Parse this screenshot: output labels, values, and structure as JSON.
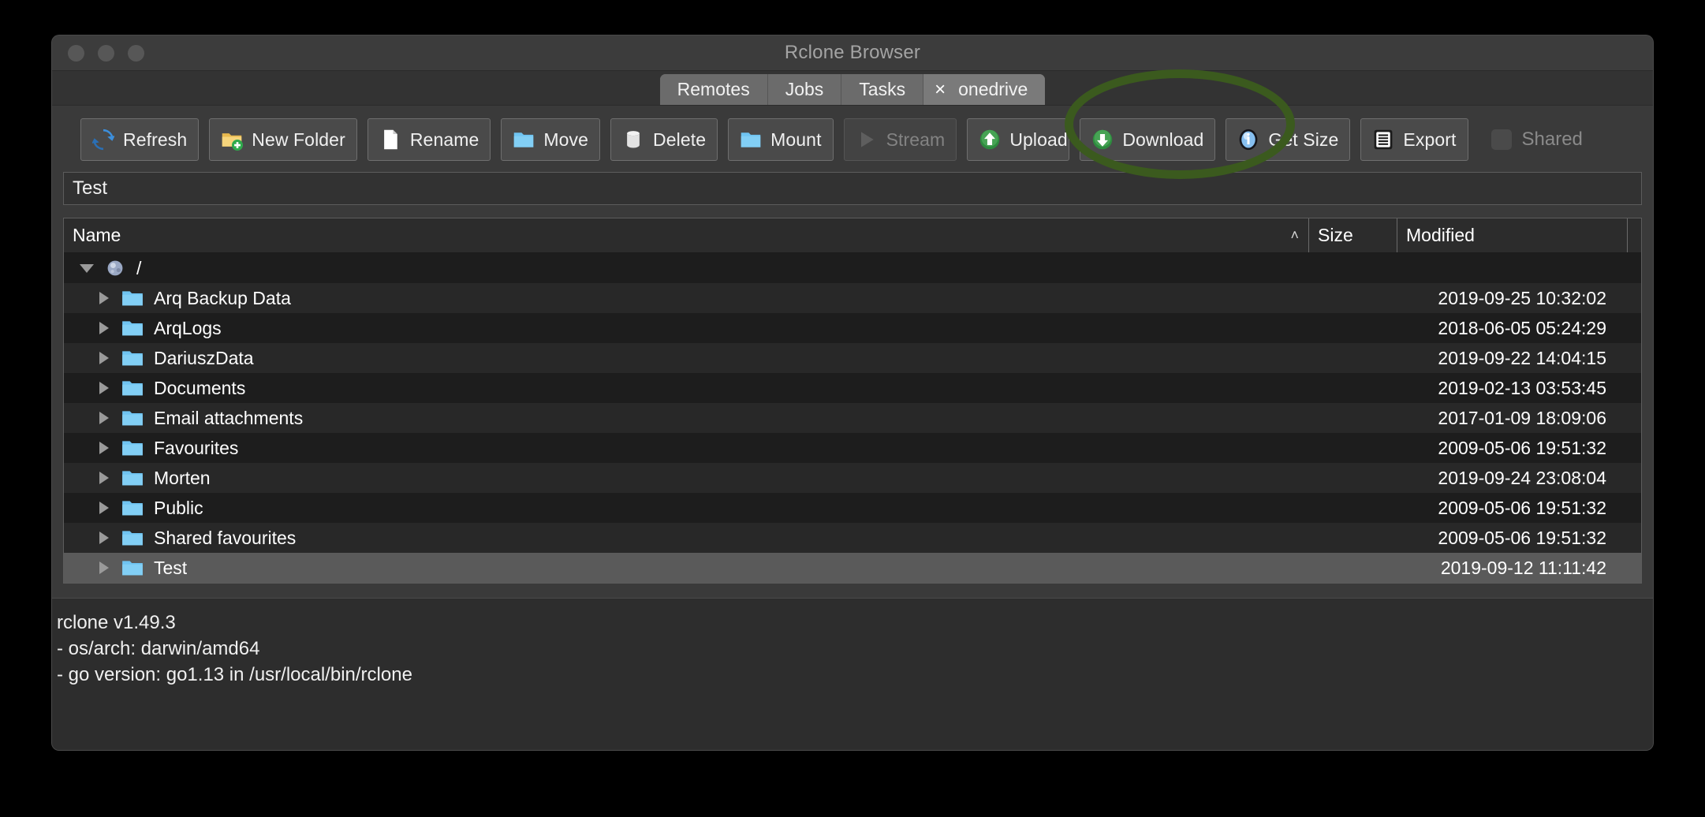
{
  "window": {
    "title": "Rclone Browser",
    "traffic_lights": [
      "close-button",
      "minimize-button",
      "maximize-button"
    ]
  },
  "tabs": [
    {
      "label": "Remotes",
      "active": false,
      "closable": false
    },
    {
      "label": "Jobs",
      "active": false,
      "closable": false
    },
    {
      "label": "Tasks",
      "active": false,
      "closable": false
    },
    {
      "label": "onedrive",
      "active": true,
      "closable": true,
      "close_glyph": "×"
    }
  ],
  "toolbar": {
    "buttons": [
      {
        "label": "Refresh",
        "icon": "refresh-icon",
        "name": "refresh-button",
        "enabled": true
      },
      {
        "label": "New Folder",
        "icon": "new-folder-icon",
        "name": "new-folder-button",
        "enabled": true
      },
      {
        "label": "Rename",
        "icon": "document-icon",
        "name": "rename-button",
        "enabled": true
      },
      {
        "label": "Move",
        "icon": "folder-icon",
        "name": "move-button",
        "enabled": true
      },
      {
        "label": "Delete",
        "icon": "trash-icon",
        "name": "delete-button",
        "enabled": true
      },
      {
        "label": "Mount",
        "icon": "folder-icon",
        "name": "mount-button",
        "enabled": true
      },
      {
        "label": "Stream",
        "icon": "play-icon",
        "name": "stream-button",
        "enabled": false
      },
      {
        "label": "Upload",
        "icon": "upload-icon",
        "name": "upload-button",
        "enabled": true
      },
      {
        "label": "Download",
        "icon": "download-icon",
        "name": "download-button",
        "enabled": true
      },
      {
        "label": "Get Size",
        "icon": "info-icon",
        "name": "get-size-button",
        "enabled": true
      },
      {
        "label": "Export",
        "icon": "export-icon",
        "name": "export-button",
        "enabled": true
      }
    ],
    "shared_checkbox": {
      "label": "Shared",
      "checked": false,
      "enabled": false
    }
  },
  "annotation": {
    "shape": "ellipse",
    "color": "#3b5a1e",
    "target": "Download"
  },
  "path_bar": {
    "value": "Test",
    "placeholder": ""
  },
  "tree": {
    "columns": [
      "Name",
      "Size",
      "Modified"
    ],
    "sort_column": "Name",
    "sort_caret": "˄",
    "root": {
      "label": "/",
      "icon": "globe-icon",
      "expanded": true
    },
    "rows": [
      {
        "name": "Arq Backup Data",
        "size": "",
        "modified": "2019-09-25 10:32:02",
        "icon": "folder-icon",
        "selected": false
      },
      {
        "name": "ArqLogs",
        "size": "",
        "modified": "2018-06-05 05:24:29",
        "icon": "folder-icon",
        "selected": false
      },
      {
        "name": "DariuszData",
        "size": "",
        "modified": "2019-09-22 14:04:15",
        "icon": "folder-icon",
        "selected": false
      },
      {
        "name": "Documents",
        "size": "",
        "modified": "2019-02-13 03:53:45",
        "icon": "folder-icon",
        "selected": false
      },
      {
        "name": "Email attachments",
        "size": "",
        "modified": "2017-01-09 18:09:06",
        "icon": "folder-icon",
        "selected": false
      },
      {
        "name": "Favourites",
        "size": "",
        "modified": "2009-05-06 19:51:32",
        "icon": "folder-icon",
        "selected": false
      },
      {
        "name": "Morten",
        "size": "",
        "modified": "2019-09-24 23:08:04",
        "icon": "folder-icon",
        "selected": false
      },
      {
        "name": "Public",
        "size": "",
        "modified": "2009-05-06 19:51:32",
        "icon": "folder-icon",
        "selected": false
      },
      {
        "name": "Shared favourites",
        "size": "",
        "modified": "2009-05-06 19:51:32",
        "icon": "folder-icon",
        "selected": false
      },
      {
        "name": "Test",
        "size": "",
        "modified": "2019-09-12 11:11:42",
        "icon": "folder-icon",
        "selected": true
      }
    ]
  },
  "log": {
    "lines": [
      "rclone v1.49.3",
      "- os/arch: darwin/amd64",
      "- go version: go1.13 in /usr/local/bin/rclone"
    ]
  }
}
